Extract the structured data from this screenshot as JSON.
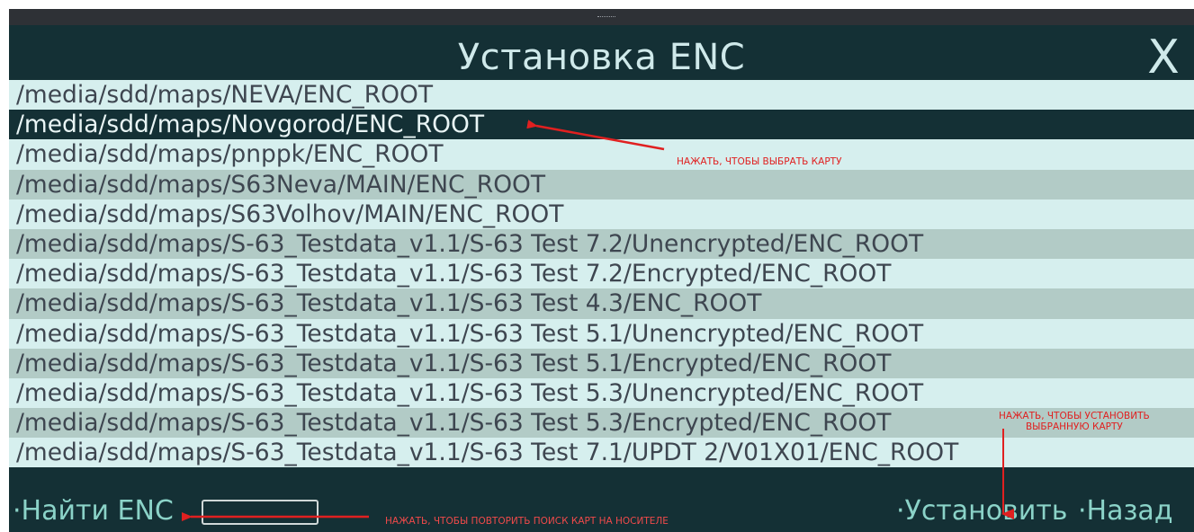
{
  "window": {
    "title": "Установка ENC",
    "close_label": "X"
  },
  "paths": [
    "/media/sdd/maps/NEVA/ENC_ROOT",
    "/media/sdd/maps/Novgorod/ENC_ROOT",
    "/media/sdd/maps/pnppk/ENC_ROOT",
    "/media/sdd/maps/S63Neva/MAIN/ENC_ROOT",
    "/media/sdd/maps/S63Volhov/MAIN/ENC_ROOT",
    "/media/sdd/maps/S-63_Testdata_v1.1/S-63 Test 7.2/Unencrypted/ENC_ROOT",
    "/media/sdd/maps/S-63_Testdata_v1.1/S-63 Test 7.2/Encrypted/ENC_ROOT",
    "/media/sdd/maps/S-63_Testdata_v1.1/S-63 Test 4.3/ENC_ROOT",
    "/media/sdd/maps/S-63_Testdata_v1.1/S-63 Test 5.1/Unencrypted/ENC_ROOT",
    "/media/sdd/maps/S-63_Testdata_v1.1/S-63 Test 5.1/Encrypted/ENC_ROOT",
    "/media/sdd/maps/S-63_Testdata_v1.1/S-63 Test 5.3/Unencrypted/ENC_ROOT",
    "/media/sdd/maps/S-63_Testdata_v1.1/S-63 Test 5.3/Encrypted/ENC_ROOT",
    "/media/sdd/maps/S-63_Testdata_v1.1/S-63 Test 7.1/UPDT 2/V01X01/ENC_ROOT"
  ],
  "selected_index": 1,
  "footer": {
    "find_label": "·Найти ENC",
    "find_value": "",
    "install_label": "·Установить",
    "back_label": "·Назад"
  },
  "annotations": {
    "select_note": "НАЖАТЬ, ЧТОБЫ ВЫБРАТЬ КАРТУ",
    "install_note_line1": "НАЖАТЬ, ЧТОБЫ УСТАНОВИТЬ",
    "install_note_line2": "ВЫБРАННУЮ КАРТУ",
    "find_note": "НАЖАТЬ, ЧТОБЫ ПОВТОРИТЬ ПОИСК КАРТ НА НОСИТЕЛЕ"
  },
  "colors": {
    "header_bg": "#143035",
    "row_light": "#d6efee",
    "row_dark": "#b2cbc6",
    "accent_text": "#8bd3c8",
    "annotation_red": "#e02020"
  },
  "icons": {
    "close": "close-icon"
  }
}
